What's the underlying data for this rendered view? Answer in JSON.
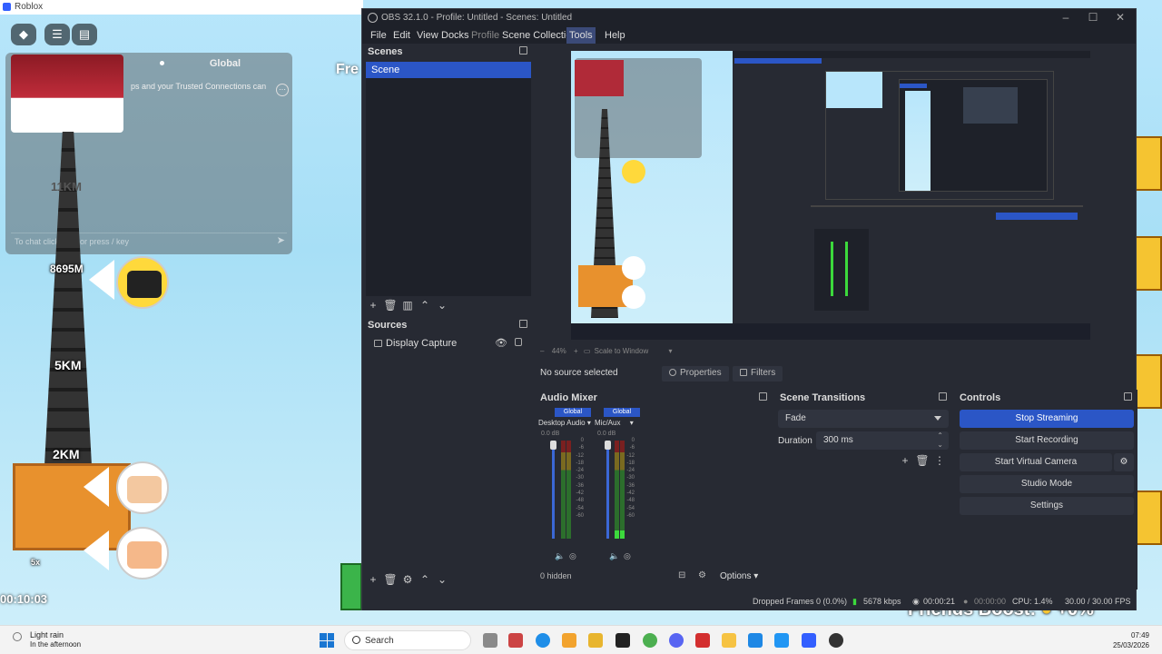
{
  "game": {
    "window_title": "Roblox",
    "chat_tab": "Global",
    "chat_message": "ps and your Trusted Connections can",
    "chat_placeholder": "To chat click here or press / key",
    "labels": {
      "km11": "11KM",
      "km8695": "8695M",
      "km5": "5KM",
      "km2": "2KM",
      "timer": "00:10:03",
      "multiplier": "5x",
      "fre": "Fre"
    },
    "boost_text": "Friends Boost:",
    "boost_value": "+0%"
  },
  "obs": {
    "title": "OBS 32.1.0 - Profile: Untitled - Scenes: Untitled",
    "menu": [
      "File",
      "Edit",
      "View",
      "Docks",
      "Profile",
      "Scene Collection",
      "Tools",
      "Help"
    ],
    "scenes": {
      "title": "Scenes",
      "items": [
        "Scene"
      ]
    },
    "sources": {
      "title": "Sources",
      "items": [
        "Display Capture"
      ]
    },
    "preview_zoom": "44%",
    "preview_scale_label": "Scale to Window",
    "info_bar": {
      "no_source": "No source selected",
      "properties": "Properties",
      "filters": "Filters"
    },
    "audio_mixer": {
      "title": "Audio Mixer",
      "channels": [
        {
          "tag": "Global",
          "name": "Desktop Audio",
          "db": "0.0 dB",
          "level": 0.0
        },
        {
          "tag": "Global",
          "name": "Mic/Aux",
          "db": "0.0 dB",
          "level": 0.08
        }
      ],
      "scale": [
        "0",
        "-6",
        "-12",
        "-18",
        "-24",
        "-30",
        "-36",
        "-42",
        "-48",
        "-54",
        "-60"
      ],
      "hidden": "0 hidden",
      "options": "Options"
    },
    "transitions": {
      "title": "Scene Transitions",
      "selected": "Fade",
      "duration_label": "Duration",
      "duration_value": "300 ms"
    },
    "controls": {
      "title": "Controls",
      "stop_streaming": "Stop Streaming",
      "start_recording": "Start Recording",
      "start_virtual_camera": "Start Virtual Camera",
      "studio_mode": "Studio Mode",
      "settings": "Settings"
    },
    "status": {
      "dropped_frames": "Dropped Frames 0 (0.0%)",
      "bitrate": "5678 kbps",
      "stream_time": "00:00:21",
      "rec_time": "00:00:00",
      "cpu": "CPU: 1.4%",
      "fps": "30.00 / 30.00 FPS"
    }
  },
  "taskbar": {
    "weather_title": "Light rain",
    "weather_sub": "In the afternoon",
    "search": "Search",
    "time": "07:49",
    "date": "25/03/2026"
  },
  "colors": {
    "accent": "#2b56c6",
    "obs_bg": "#272a33",
    "obs_panel": "#1e2129",
    "sky": "#b8e6fb"
  }
}
